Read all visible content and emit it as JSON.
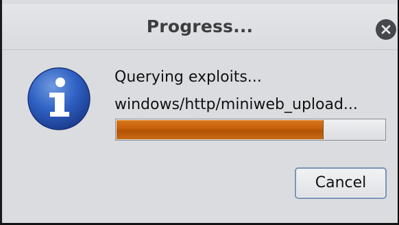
{
  "window": {
    "title": "Progress...",
    "close_icon": "close-icon"
  },
  "message": {
    "icon": "info-icon",
    "line1": "Querying exploits...",
    "line2": "windows/http/miniweb_upload..."
  },
  "progress": {
    "fraction": 0.77,
    "fill_color": "#c7600b"
  },
  "buttons": {
    "cancel_label": "Cancel"
  }
}
